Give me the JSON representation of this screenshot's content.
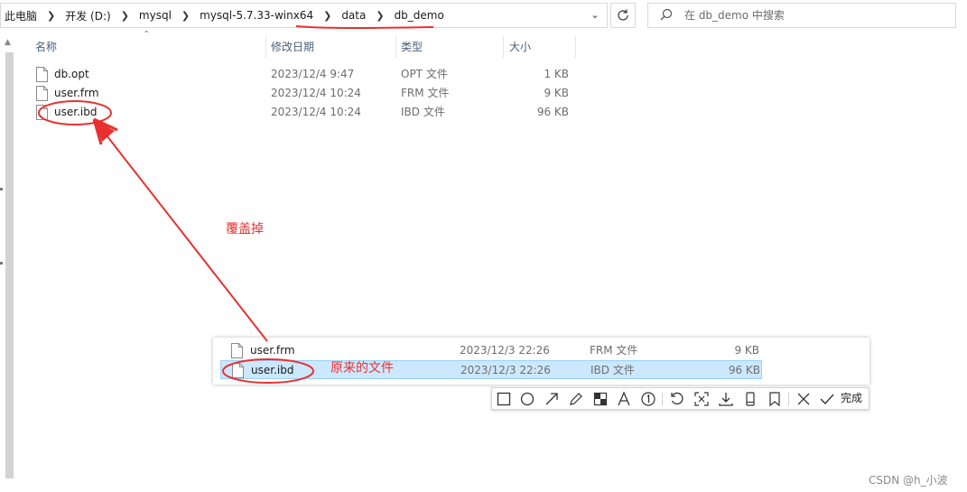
{
  "breadcrumb": [
    "此电脑",
    "开发 (D:)",
    "mysql",
    "mysql-5.7.33-winx64",
    "data",
    "db_demo"
  ],
  "search": {
    "placeholder": "在 db_demo 中搜索"
  },
  "columns": {
    "name": "名称",
    "date": "修改日期",
    "type": "类型",
    "size": "大小"
  },
  "files": [
    {
      "name": "db.opt",
      "date": "2023/12/4 9:47",
      "type": "OPT 文件",
      "size": "1 KB"
    },
    {
      "name": "user.frm",
      "date": "2023/12/4 10:24",
      "type": "FRM 文件",
      "size": "9 KB"
    },
    {
      "name": "user.ibd",
      "date": "2023/12/4 10:24",
      "type": "IBD 文件",
      "size": "96 KB"
    }
  ],
  "annotations": {
    "overwrite": "覆盖掉",
    "original": "原来的文件"
  },
  "original_files": [
    {
      "name": "user.frm",
      "date": "2023/12/3 22:26",
      "type": "FRM 文件",
      "size": "9 KB"
    },
    {
      "name": "user.ibd",
      "date": "2023/12/3 22:26",
      "type": "IBD 文件",
      "size": "96 KB"
    }
  ],
  "snip_toolbar": {
    "tools": [
      "rectangle-icon",
      "circle-icon",
      "arrow-icon",
      "pen-icon",
      "mosaic-icon",
      "text-icon",
      "number-icon",
      "undo-icon",
      "pin-icon",
      "download-icon",
      "phone-icon",
      "save-icon",
      "close-icon",
      "check-icon"
    ],
    "done_label": "完成"
  },
  "watermark": "CSDN @h_小波",
  "colors": {
    "annotation": "#e8312f",
    "selection": "#cce8ff",
    "header_text": "#4c607a"
  }
}
